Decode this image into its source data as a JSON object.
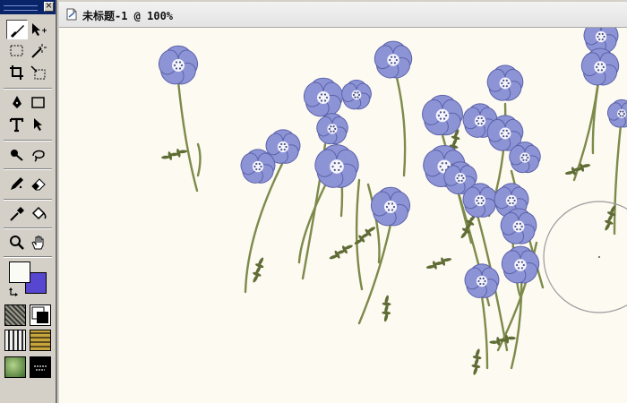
{
  "toolbox": {
    "tools": [
      {
        "name": "brush-tool",
        "icon": "brush-icon",
        "active": true
      },
      {
        "name": "subselect-tool",
        "icon": "subselect-arrow-icon"
      },
      {
        "name": "marquee-tool",
        "icon": "marquee-icon"
      },
      {
        "name": "magic-wand-tool",
        "icon": "magic-wand-icon"
      },
      {
        "name": "crop-tool",
        "icon": "crop-icon"
      },
      {
        "name": "slice-tool",
        "icon": "slice-icon"
      },
      {
        "name": "pen-tool",
        "icon": "pen-icon"
      },
      {
        "name": "rectangle-tool",
        "icon": "rectangle-icon"
      },
      {
        "name": "text-tool",
        "icon": "text-icon"
      },
      {
        "name": "pointer-tool",
        "icon": "pointer-icon"
      },
      {
        "name": "rubber-stamp-tool",
        "icon": "rubber-stamp-icon"
      },
      {
        "name": "lasso-tool",
        "icon": "lasso-icon"
      },
      {
        "name": "pencil-tool",
        "icon": "pencil-icon"
      },
      {
        "name": "eraser-tool",
        "icon": "eraser-icon"
      },
      {
        "name": "eyedropper-tool",
        "icon": "eyedropper-icon"
      },
      {
        "name": "paint-bucket-tool",
        "icon": "paint-bucket-icon"
      },
      {
        "name": "zoom-tool",
        "icon": "magnifier-icon"
      },
      {
        "name": "hand-tool",
        "icon": "hand-icon"
      }
    ],
    "colors": {
      "foreground": "#fbfbf6",
      "background": "#5746d0"
    }
  },
  "document": {
    "title": "未标题-1 @ 100%",
    "canvas_background": "#fdfaf2"
  },
  "colors": {
    "flower": "#8d94d6",
    "flower_dark": "#5b62a8",
    "stem": "#7d8a4a",
    "leaf": "#5f6c34"
  }
}
